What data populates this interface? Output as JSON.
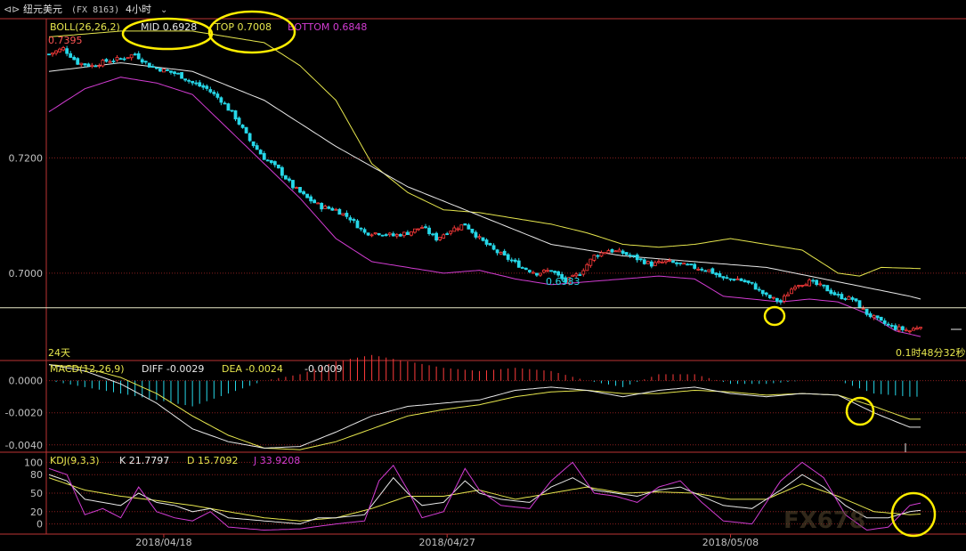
{
  "header": {
    "icon": "back-arrow-icon",
    "symbol": "纽元美元",
    "code": "(FX 8163)",
    "period": "4小时",
    "period_icon": "chevron-down-icon"
  },
  "price_panel": {
    "indicator": "BOLL(26,26,2)",
    "mid_label": "MID 0.6928",
    "top_label": "TOP 0.7008",
    "bottom_label": "BOTTOM 0.6848",
    "high_mark": "0.7395",
    "low_mark": "0.6983",
    "span_label": "24天",
    "countdown": "0.1时48分32秒",
    "colors": {
      "up": "#ff3b3b",
      "down": "#26d7e8",
      "mid": "#e8e8e8",
      "top": "#e6e64d",
      "bottom": "#d23cd2"
    }
  },
  "macd_panel": {
    "indicator": "MACD(12,26,9)",
    "diff_label": "DIFF -0.0029",
    "dea_label": "DEA -0.0024",
    "macd_label": "-0.0009"
  },
  "kdj_panel": {
    "indicator": "KDJ(9,3,3)",
    "k_label": "K 21.7797",
    "d_label": "D 15.7092",
    "j_label": "J 33.9208"
  },
  "watermark": "FX678",
  "chart_data": [
    {
      "type": "candlestick",
      "x_labels": [
        "2018/04/18",
        "2018/04/27",
        "2018/05/08"
      ],
      "ylim": [
        0.685,
        0.744
      ],
      "yticks": [
        0.72,
        0.7
      ],
      "ytick_labels": [
        "0.7200",
        "0.7000"
      ],
      "reference_line": 0.694,
      "close_anchors": [
        [
          0,
          0.738
        ],
        [
          4,
          0.739
        ],
        [
          8,
          0.7365
        ],
        [
          12,
          0.736
        ],
        [
          16,
          0.7368
        ],
        [
          20,
          0.7372
        ],
        [
          24,
          0.738
        ],
        [
          28,
          0.736
        ],
        [
          32,
          0.7352
        ],
        [
          36,
          0.7345
        ],
        [
          40,
          0.733
        ],
        [
          44,
          0.732
        ],
        [
          48,
          0.73
        ],
        [
          52,
          0.727
        ],
        [
          56,
          0.723
        ],
        [
          60,
          0.72
        ],
        [
          64,
          0.718
        ],
        [
          68,
          0.715
        ],
        [
          72,
          0.713
        ],
        [
          76,
          0.7115
        ],
        [
          80,
          0.711
        ],
        [
          84,
          0.7095
        ],
        [
          88,
          0.707
        ],
        [
          92,
          0.707
        ],
        [
          96,
          0.7065
        ],
        [
          100,
          0.707
        ],
        [
          104,
          0.708
        ],
        [
          108,
          0.706
        ],
        [
          112,
          0.7075
        ],
        [
          116,
          0.7085
        ],
        [
          120,
          0.706
        ],
        [
          124,
          0.704
        ],
        [
          128,
          0.7025
        ],
        [
          132,
          0.701
        ],
        [
          136,
          0.7
        ],
        [
          140,
          0.7005
        ],
        [
          144,
          0.6985
        ],
        [
          148,
          0.7
        ],
        [
          152,
          0.703
        ],
        [
          156,
          0.704
        ],
        [
          160,
          0.7035
        ],
        [
          164,
          0.7025
        ],
        [
          168,
          0.7015
        ],
        [
          172,
          0.702
        ],
        [
          176,
          0.7015
        ],
        [
          180,
          0.701
        ],
        [
          184,
          0.7005
        ],
        [
          188,
          0.699
        ],
        [
          192,
          0.699
        ],
        [
          196,
          0.698
        ],
        [
          200,
          0.696
        ],
        [
          204,
          0.695
        ],
        [
          208,
          0.698
        ],
        [
          212,
          0.6985
        ],
        [
          216,
          0.6975
        ],
        [
          220,
          0.696
        ],
        [
          224,
          0.6955
        ],
        [
          228,
          0.693
        ],
        [
          232,
          0.6915
        ],
        [
          236,
          0.6905
        ],
        [
          240,
          0.69
        ],
        [
          243,
          0.691
        ]
      ],
      "boll_mid": [
        [
          0,
          0.735
        ],
        [
          20,
          0.7365
        ],
        [
          40,
          0.735
        ],
        [
          60,
          0.73
        ],
        [
          80,
          0.722
        ],
        [
          100,
          0.715
        ],
        [
          120,
          0.71
        ],
        [
          140,
          0.705
        ],
        [
          160,
          0.703
        ],
        [
          180,
          0.702
        ],
        [
          200,
          0.701
        ],
        [
          220,
          0.6985
        ],
        [
          240,
          0.696
        ],
        [
          243,
          0.6955
        ]
      ],
      "boll_top": [
        [
          0,
          0.741
        ],
        [
          20,
          0.742
        ],
        [
          40,
          0.742
        ],
        [
          50,
          0.741
        ],
        [
          60,
          0.74
        ],
        [
          70,
          0.736
        ],
        [
          80,
          0.73
        ],
        [
          90,
          0.719
        ],
        [
          100,
          0.714
        ],
        [
          110,
          0.711
        ],
        [
          120,
          0.7105
        ],
        [
          130,
          0.7095
        ],
        [
          140,
          0.7085
        ],
        [
          150,
          0.707
        ],
        [
          160,
          0.705
        ],
        [
          170,
          0.7045
        ],
        [
          180,
          0.705
        ],
        [
          190,
          0.706
        ],
        [
          200,
          0.705
        ],
        [
          210,
          0.704
        ],
        [
          220,
          0.7
        ],
        [
          226,
          0.6995
        ],
        [
          232,
          0.701
        ],
        [
          243,
          0.7008
        ]
      ],
      "boll_bottom": [
        [
          0,
          0.728
        ],
        [
          10,
          0.732
        ],
        [
          20,
          0.734
        ],
        [
          30,
          0.733
        ],
        [
          40,
          0.731
        ],
        [
          50,
          0.725
        ],
        [
          60,
          0.719
        ],
        [
          70,
          0.713
        ],
        [
          80,
          0.706
        ],
        [
          90,
          0.702
        ],
        [
          100,
          0.701
        ],
        [
          110,
          0.7
        ],
        [
          120,
          0.7005
        ],
        [
          130,
          0.699
        ],
        [
          140,
          0.698
        ],
        [
          150,
          0.6985
        ],
        [
          160,
          0.699
        ],
        [
          170,
          0.6995
        ],
        [
          180,
          0.699
        ],
        [
          188,
          0.696
        ],
        [
          196,
          0.6955
        ],
        [
          204,
          0.695
        ],
        [
          212,
          0.6955
        ],
        [
          220,
          0.695
        ],
        [
          228,
          0.693
        ],
        [
          236,
          0.69
        ],
        [
          243,
          0.689
        ]
      ]
    },
    {
      "type": "bar",
      "title": "MACD(12,26,9)",
      "ylim": [
        -0.0044,
        0.0012
      ],
      "yticks": [
        0.0,
        -0.002,
        -0.004
      ],
      "ytick_labels": [
        "0.0000",
        "-0.0020",
        "-0.0040"
      ],
      "diff": [
        [
          0,
          0.001
        ],
        [
          10,
          0.0006
        ],
        [
          20,
          -0.0002
        ],
        [
          30,
          -0.0014
        ],
        [
          40,
          -0.003
        ],
        [
          50,
          -0.0038
        ],
        [
          60,
          -0.0042
        ],
        [
          70,
          -0.0041
        ],
        [
          80,
          -0.0032
        ],
        [
          90,
          -0.0022
        ],
        [
          100,
          -0.0016
        ],
        [
          110,
          -0.0014
        ],
        [
          120,
          -0.0012
        ],
        [
          130,
          -0.0006
        ],
        [
          140,
          -0.0004
        ],
        [
          150,
          -0.0006
        ],
        [
          160,
          -0.001
        ],
        [
          170,
          -0.0006
        ],
        [
          180,
          -0.0004
        ],
        [
          190,
          -0.0008
        ],
        [
          200,
          -0.001
        ],
        [
          210,
          -0.0008
        ],
        [
          220,
          -0.0009
        ],
        [
          230,
          -0.002
        ],
        [
          240,
          -0.0029
        ],
        [
          243,
          -0.0029
        ]
      ],
      "dea": [
        [
          0,
          0.001
        ],
        [
          10,
          0.0008
        ],
        [
          20,
          0.0002
        ],
        [
          30,
          -0.0008
        ],
        [
          40,
          -0.0022
        ],
        [
          50,
          -0.0034
        ],
        [
          60,
          -0.0042
        ],
        [
          70,
          -0.0043
        ],
        [
          80,
          -0.0038
        ],
        [
          90,
          -0.003
        ],
        [
          100,
          -0.0022
        ],
        [
          110,
          -0.0018
        ],
        [
          120,
          -0.0015
        ],
        [
          130,
          -0.001
        ],
        [
          140,
          -0.0007
        ],
        [
          150,
          -0.0006
        ],
        [
          160,
          -0.0008
        ],
        [
          170,
          -0.0008
        ],
        [
          180,
          -0.0006
        ],
        [
          190,
          -0.0007
        ],
        [
          200,
          -0.0009
        ],
        [
          210,
          -0.0008
        ],
        [
          220,
          -0.0009
        ],
        [
          230,
          -0.0016
        ],
        [
          240,
          -0.0024
        ],
        [
          243,
          -0.0024
        ]
      ]
    },
    {
      "type": "line",
      "title": "KDJ(9,3,3)",
      "ylim": [
        -15,
        115
      ],
      "yticks": [
        100,
        80,
        50,
        20,
        0
      ],
      "ytick_labels": [
        "100",
        "80",
        "50",
        "20",
        "0"
      ],
      "k": [
        [
          0,
          80
        ],
        [
          5,
          70
        ],
        [
          10,
          40
        ],
        [
          15,
          35
        ],
        [
          20,
          30
        ],
        [
          25,
          50
        ],
        [
          30,
          35
        ],
        [
          35,
          30
        ],
        [
          40,
          20
        ],
        [
          45,
          25
        ],
        [
          50,
          10
        ],
        [
          60,
          5
        ],
        [
          70,
          0
        ],
        [
          75,
          10
        ],
        [
          80,
          10
        ],
        [
          88,
          15
        ],
        [
          92,
          45
        ],
        [
          96,
          75
        ],
        [
          100,
          50
        ],
        [
          104,
          30
        ],
        [
          110,
          35
        ],
        [
          116,
          70
        ],
        [
          120,
          50
        ],
        [
          126,
          40
        ],
        [
          134,
          35
        ],
        [
          140,
          60
        ],
        [
          146,
          75
        ],
        [
          152,
          55
        ],
        [
          158,
          50
        ],
        [
          164,
          45
        ],
        [
          170,
          55
        ],
        [
          176,
          60
        ],
        [
          182,
          45
        ],
        [
          188,
          30
        ],
        [
          196,
          25
        ],
        [
          204,
          55
        ],
        [
          210,
          80
        ],
        [
          216,
          60
        ],
        [
          222,
          30
        ],
        [
          228,
          10
        ],
        [
          234,
          10
        ],
        [
          240,
          20
        ],
        [
          243,
          22
        ]
      ],
      "d": [
        [
          0,
          75
        ],
        [
          10,
          55
        ],
        [
          20,
          45
        ],
        [
          30,
          38
        ],
        [
          40,
          30
        ],
        [
          50,
          20
        ],
        [
          60,
          10
        ],
        [
          70,
          5
        ],
        [
          80,
          10
        ],
        [
          90,
          25
        ],
        [
          100,
          45
        ],
        [
          110,
          45
        ],
        [
          120,
          55
        ],
        [
          130,
          40
        ],
        [
          140,
          50
        ],
        [
          150,
          60
        ],
        [
          160,
          50
        ],
        [
          170,
          52
        ],
        [
          180,
          50
        ],
        [
          190,
          40
        ],
        [
          200,
          40
        ],
        [
          210,
          65
        ],
        [
          220,
          45
        ],
        [
          230,
          20
        ],
        [
          240,
          15
        ],
        [
          243,
          16
        ]
      ],
      "j": [
        [
          0,
          90
        ],
        [
          5,
          80
        ],
        [
          10,
          15
        ],
        [
          15,
          25
        ],
        [
          20,
          10
        ],
        [
          25,
          60
        ],
        [
          30,
          20
        ],
        [
          35,
          10
        ],
        [
          40,
          5
        ],
        [
          45,
          20
        ],
        [
          50,
          -5
        ],
        [
          60,
          -10
        ],
        [
          70,
          -8
        ],
        [
          80,
          0
        ],
        [
          88,
          5
        ],
        [
          92,
          70
        ],
        [
          96,
          95
        ],
        [
          100,
          55
        ],
        [
          104,
          10
        ],
        [
          110,
          20
        ],
        [
          116,
          90
        ],
        [
          120,
          55
        ],
        [
          126,
          30
        ],
        [
          134,
          25
        ],
        [
          140,
          70
        ],
        [
          146,
          100
        ],
        [
          152,
          50
        ],
        [
          158,
          45
        ],
        [
          164,
          35
        ],
        [
          170,
          60
        ],
        [
          176,
          70
        ],
        [
          182,
          35
        ],
        [
          188,
          5
        ],
        [
          196,
          0
        ],
        [
          204,
          70
        ],
        [
          210,
          100
        ],
        [
          216,
          75
        ],
        [
          222,
          15
        ],
        [
          228,
          -10
        ],
        [
          234,
          -5
        ],
        [
          240,
          30
        ],
        [
          243,
          34
        ]
      ]
    }
  ]
}
